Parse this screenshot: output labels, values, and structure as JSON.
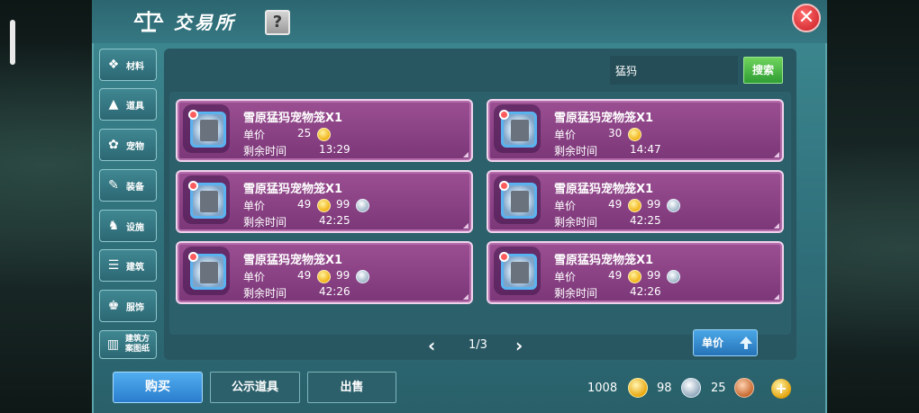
{
  "header": {
    "title": "交易所",
    "help_label": "?",
    "close_label": "✕"
  },
  "sidebar": {
    "items": [
      {
        "label": "材料",
        "icon": "materials-icon"
      },
      {
        "label": "道具",
        "icon": "items-icon"
      },
      {
        "label": "宠物",
        "icon": "pet-icon"
      },
      {
        "label": "装备",
        "icon": "equipment-icon"
      },
      {
        "label": "设施",
        "icon": "facility-icon"
      },
      {
        "label": "建筑",
        "icon": "building-icon"
      },
      {
        "label": "服饰",
        "icon": "clothing-icon"
      },
      {
        "label": "建筑方案图纸",
        "icon": "blueprint-icon"
      }
    ]
  },
  "search": {
    "value": "猛犸",
    "button_label": "搜索"
  },
  "listings": [
    {
      "name": "雪原猛犸宠物笼X1",
      "price_label": "单价",
      "gold": "25",
      "silver": "",
      "time_label": "剩余时间",
      "time": "13:29"
    },
    {
      "name": "雪原猛犸宠物笼X1",
      "price_label": "单价",
      "gold": "30",
      "silver": "",
      "time_label": "剩余时间",
      "time": "14:47"
    },
    {
      "name": "雪原猛犸宠物笼X1",
      "price_label": "单价",
      "gold": "49",
      "silver": "99",
      "time_label": "剩余时间",
      "time": "42:25"
    },
    {
      "name": "雪原猛犸宠物笼X1",
      "price_label": "单价",
      "gold": "49",
      "silver": "99",
      "time_label": "剩余时间",
      "time": "42:25"
    },
    {
      "name": "雪原猛犸宠物笼X1",
      "price_label": "单价",
      "gold": "49",
      "silver": "99",
      "time_label": "剩余时间",
      "time": "42:26"
    },
    {
      "name": "雪原猛犸宠物笼X1",
      "price_label": "单价",
      "gold": "49",
      "silver": "99",
      "time_label": "剩余时间",
      "time": "42:26"
    }
  ],
  "pagination": {
    "text": "1/3",
    "prev": "‹",
    "next": "›"
  },
  "sort": {
    "label": "单价"
  },
  "bottom": {
    "buy_label": "购买",
    "public_label": "公示道具",
    "sell_label": "出售",
    "gold": "1008",
    "silver": "98",
    "bronze": "25",
    "plus": "+"
  },
  "colors": {
    "card_bg": "#8b4585",
    "panel": "#357883",
    "search_btn": "#3fb23f",
    "buy_btn": "#2a7dcd"
  }
}
